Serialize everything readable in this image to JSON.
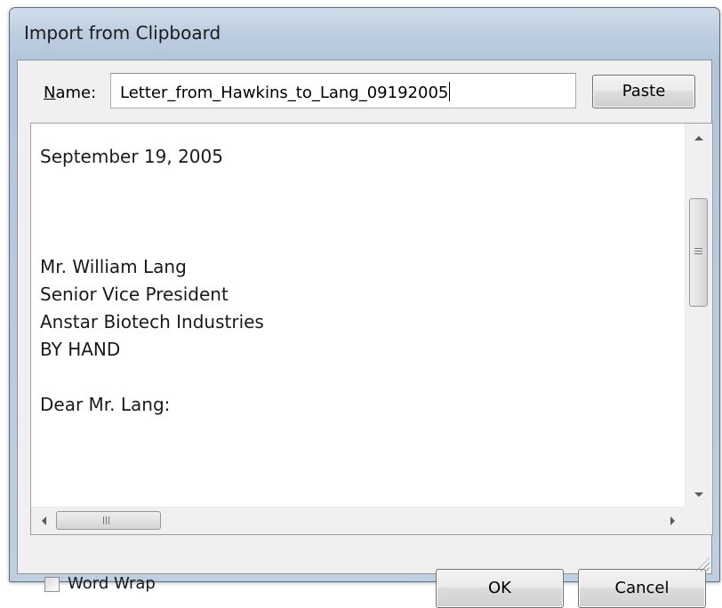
{
  "window": {
    "title": "Import from Clipboard"
  },
  "name_row": {
    "label_accel": "N",
    "label_rest": "ame:",
    "value": "Letter_from_Hawkins_to_Lang_09192005",
    "paste_label": "Paste"
  },
  "text": {
    "content": "September 19, 2005\n\n\n\nMr. William Lang\nSenior Vice President\nAnstar Biotech Industries\nBY HAND\n\nDear Mr. Lang:"
  },
  "footer": {
    "word_wrap_label": "Word Wrap",
    "word_wrap_checked": false,
    "ok_label": "OK",
    "cancel_label": "Cancel"
  },
  "icons": {
    "vertical_scroll_grip": "grip-lines-icon",
    "horizontal_scroll_grip": "grip-lines-icon",
    "resize": "resize-grip-icon"
  }
}
